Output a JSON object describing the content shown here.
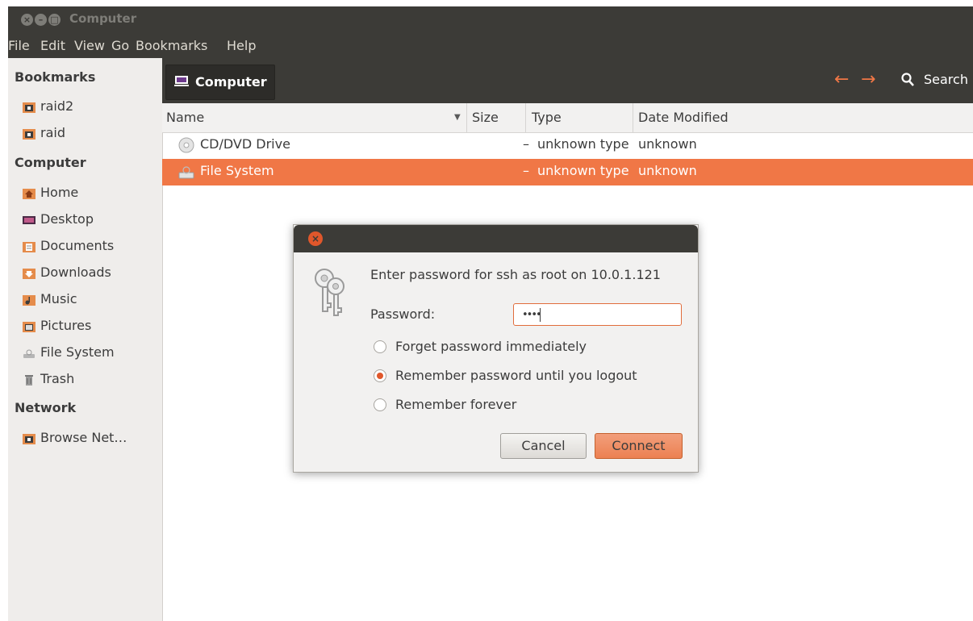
{
  "window": {
    "title": "Computer"
  },
  "menubar": {
    "items": [
      "File",
      "Edit",
      "View",
      "Go",
      "Bookmarks",
      "Help"
    ]
  },
  "sidebar": {
    "sections": [
      {
        "heading": "Bookmarks",
        "items": [
          {
            "label": "raid2",
            "icon": "network-folder-icon"
          },
          {
            "label": "raid",
            "icon": "network-folder-icon"
          }
        ]
      },
      {
        "heading": "Computer",
        "items": [
          {
            "label": "Home",
            "icon": "home-folder-icon"
          },
          {
            "label": "Desktop",
            "icon": "desktop-icon"
          },
          {
            "label": "Documents",
            "icon": "documents-folder-icon"
          },
          {
            "label": "Downloads",
            "icon": "downloads-folder-icon"
          },
          {
            "label": "Music",
            "icon": "music-folder-icon"
          },
          {
            "label": "Pictures",
            "icon": "pictures-folder-icon"
          },
          {
            "label": "File System",
            "icon": "harddisk-icon"
          },
          {
            "label": "Trash",
            "icon": "trash-icon"
          }
        ]
      },
      {
        "heading": "Network",
        "items": [
          {
            "label": "Browse Net…",
            "icon": "network-icon"
          }
        ]
      }
    ]
  },
  "toolbar": {
    "location": "Computer",
    "search_label": "Search"
  },
  "columns": {
    "name": "Name",
    "size": "Size",
    "type": "Type",
    "date": "Date Modified"
  },
  "files": [
    {
      "name": "CD/DVD Drive",
      "size": "–",
      "type": "unknown type",
      "date": "unknown",
      "selected": false,
      "icon": "optical-drive-icon"
    },
    {
      "name": "File System",
      "size": "–",
      "type": "unknown type",
      "date": "unknown",
      "selected": true,
      "icon": "harddisk-icon"
    }
  ],
  "dialog": {
    "message": "Enter password for ssh as root on 10.0.1.121",
    "password_label": "Password:",
    "password_value": "••••",
    "options": [
      {
        "label": "Forget password immediately",
        "checked": false
      },
      {
        "label": "Remember password until you logout",
        "checked": true
      },
      {
        "label": "Remember forever",
        "checked": false
      }
    ],
    "cancel_label": "Cancel",
    "connect_label": "Connect"
  },
  "colors": {
    "accent": "#f07746",
    "titlebar": "#3c3b37",
    "sidebar_bg": "#efedeb"
  }
}
